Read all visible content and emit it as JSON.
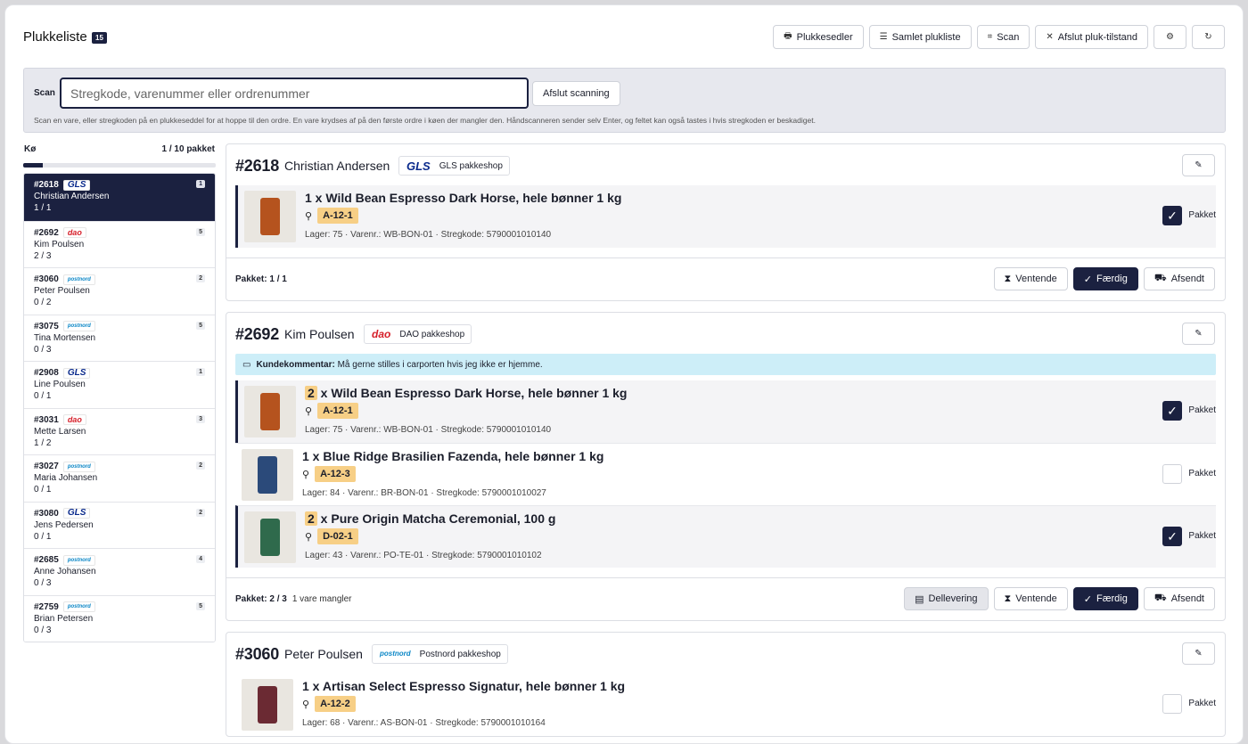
{
  "header": {
    "title": "Plukkeliste",
    "count": "15",
    "toolbar": [
      {
        "icon": "printer-icon",
        "glyph": "🖶",
        "label": "Plukkesedler"
      },
      {
        "icon": "list-icon",
        "glyph": "☰",
        "label": "Samlet plukliste"
      },
      {
        "icon": "scan-icon",
        "glyph": "⌗",
        "label": "Scan"
      },
      {
        "icon": "exit-icon",
        "glyph": "✕",
        "label": "Afslut pluk-tilstand"
      }
    ],
    "settings_glyph": "⚙",
    "refresh_glyph": "↻"
  },
  "scan": {
    "label": "Scan",
    "placeholder": "Stregkode, varenummer eller ordrenummer",
    "stop_label": "Afslut scanning",
    "help": "Scan en vare, eller stregkoden på en plukkeseddel for at hoppe til den ordre. En vare krydses af på den første ordre i køen der mangler den. Håndscanneren sender selv Enter, og feltet kan også tastes i hvis stregkoden er beskadiget."
  },
  "queue": {
    "label": "Kø",
    "progress_text": "1 / 10 pakket",
    "progress_fraction": 0.1,
    "items": [
      {
        "num": "#2618",
        "carrier": "gls",
        "carrier_text": "GLS",
        "name": "Christian Andersen",
        "progress": "1 / 1",
        "badge": "1",
        "active": true
      },
      {
        "num": "#2692",
        "carrier": "dao",
        "carrier_text": "dao",
        "name": "Kim Poulsen",
        "progress": "2 / 3",
        "badge": "5",
        "active": false
      },
      {
        "num": "#3060",
        "carrier": "pn",
        "carrier_text": "postnord",
        "name": "Peter Poulsen",
        "progress": "0 / 2",
        "badge": "2",
        "active": false
      },
      {
        "num": "#3075",
        "carrier": "pn",
        "carrier_text": "postnord",
        "name": "Tina Mortensen",
        "progress": "0 / 3",
        "badge": "5",
        "active": false
      },
      {
        "num": "#2908",
        "carrier": "gls",
        "carrier_text": "GLS",
        "name": "Line Poulsen",
        "progress": "0 / 1",
        "badge": "1",
        "active": false
      },
      {
        "num": "#3031",
        "carrier": "dao",
        "carrier_text": "dao",
        "name": "Mette Larsen",
        "progress": "1 / 2",
        "badge": "3",
        "active": false
      },
      {
        "num": "#3027",
        "carrier": "pn",
        "carrier_text": "postnord",
        "name": "Maria Johansen",
        "progress": "0 / 1",
        "badge": "2",
        "active": false
      },
      {
        "num": "#3080",
        "carrier": "gls",
        "carrier_text": "GLS",
        "name": "Jens Pedersen",
        "progress": "0 / 1",
        "badge": "2",
        "active": false
      },
      {
        "num": "#2685",
        "carrier": "pn",
        "carrier_text": "postnord",
        "name": "Anne Johansen",
        "progress": "0 / 3",
        "badge": "4",
        "active": false
      },
      {
        "num": "#2759",
        "carrier": "pn",
        "carrier_text": "postnord",
        "name": "Brian Petersen",
        "progress": "0 / 3",
        "badge": "5",
        "active": false
      }
    ]
  },
  "orders": [
    {
      "num": "#2618",
      "name": "Christian Andersen",
      "carrier": "gls",
      "carrier_text": "GLS",
      "shop": "GLS pakkeshop",
      "comment": null,
      "lines": [
        {
          "qty": "1",
          "name": "Wild Bean Espresso Dark Horse, hele bønner 1 kg",
          "loc": "A-12-1",
          "meta": "Lager: 75 · Varenr.: WB-BON-01 · Stregkode: 5790001010140",
          "packed": true,
          "can_color": "#b5531e"
        }
      ],
      "status": "Pakket: 1 / 1",
      "missing": "",
      "buttons": [
        "Ventende",
        "Færdig",
        "Afsendt"
      ]
    },
    {
      "num": "#2692",
      "name": "Kim Poulsen",
      "carrier": "dao",
      "carrier_text": "dao",
      "shop": "DAO pakkeshop",
      "comment": {
        "label": "Kundekommentar:",
        "text": "Må gerne stilles i carporten hvis jeg ikke er hjemme."
      },
      "lines": [
        {
          "qty": "2",
          "name": "Wild Bean Espresso Dark Horse, hele bønner 1 kg",
          "loc": "A-12-1",
          "meta": "Lager: 75 · Varenr.: WB-BON-01 · Stregkode: 5790001010140",
          "packed": true,
          "can_color": "#b5531e"
        },
        {
          "qty": "1",
          "name": "Blue Ridge Brasilien Fazenda, hele bønner 1 kg",
          "loc": "A-12-3",
          "meta": "Lager: 84 · Varenr.: BR-BON-01 · Stregkode: 5790001010027",
          "packed": false,
          "can_color": "#2b4a7a"
        },
        {
          "qty": "2",
          "name": "Pure Origin Matcha Ceremonial, 100 g",
          "loc": "D-02-1",
          "meta": "Lager: 43 · Varenr.: PO-TE-01 · Stregkode: 5790001010102",
          "packed": true,
          "can_color": "#2f6a4c"
        }
      ],
      "status": "Pakket: 2 / 3",
      "missing": "1 vare mangler",
      "buttons": [
        "Dellevering",
        "Ventende",
        "Færdig",
        "Afsendt"
      ]
    },
    {
      "num": "#3060",
      "name": "Peter Poulsen",
      "carrier": "pn",
      "carrier_text": "postnord",
      "shop": "Postnord pakkeshop",
      "comment": null,
      "lines": [
        {
          "qty": "1",
          "name": "Artisan Select Espresso Signatur, hele bønner 1 kg",
          "loc": "A-12-2",
          "meta": "Lager: 68 · Varenr.: AS-BON-01 · Stregkode: 5790001010164",
          "packed": false,
          "can_color": "#6b2a33"
        }
      ],
      "status": "",
      "missing": "",
      "buttons": []
    }
  ],
  "labels": {
    "packed": "Pakket"
  }
}
